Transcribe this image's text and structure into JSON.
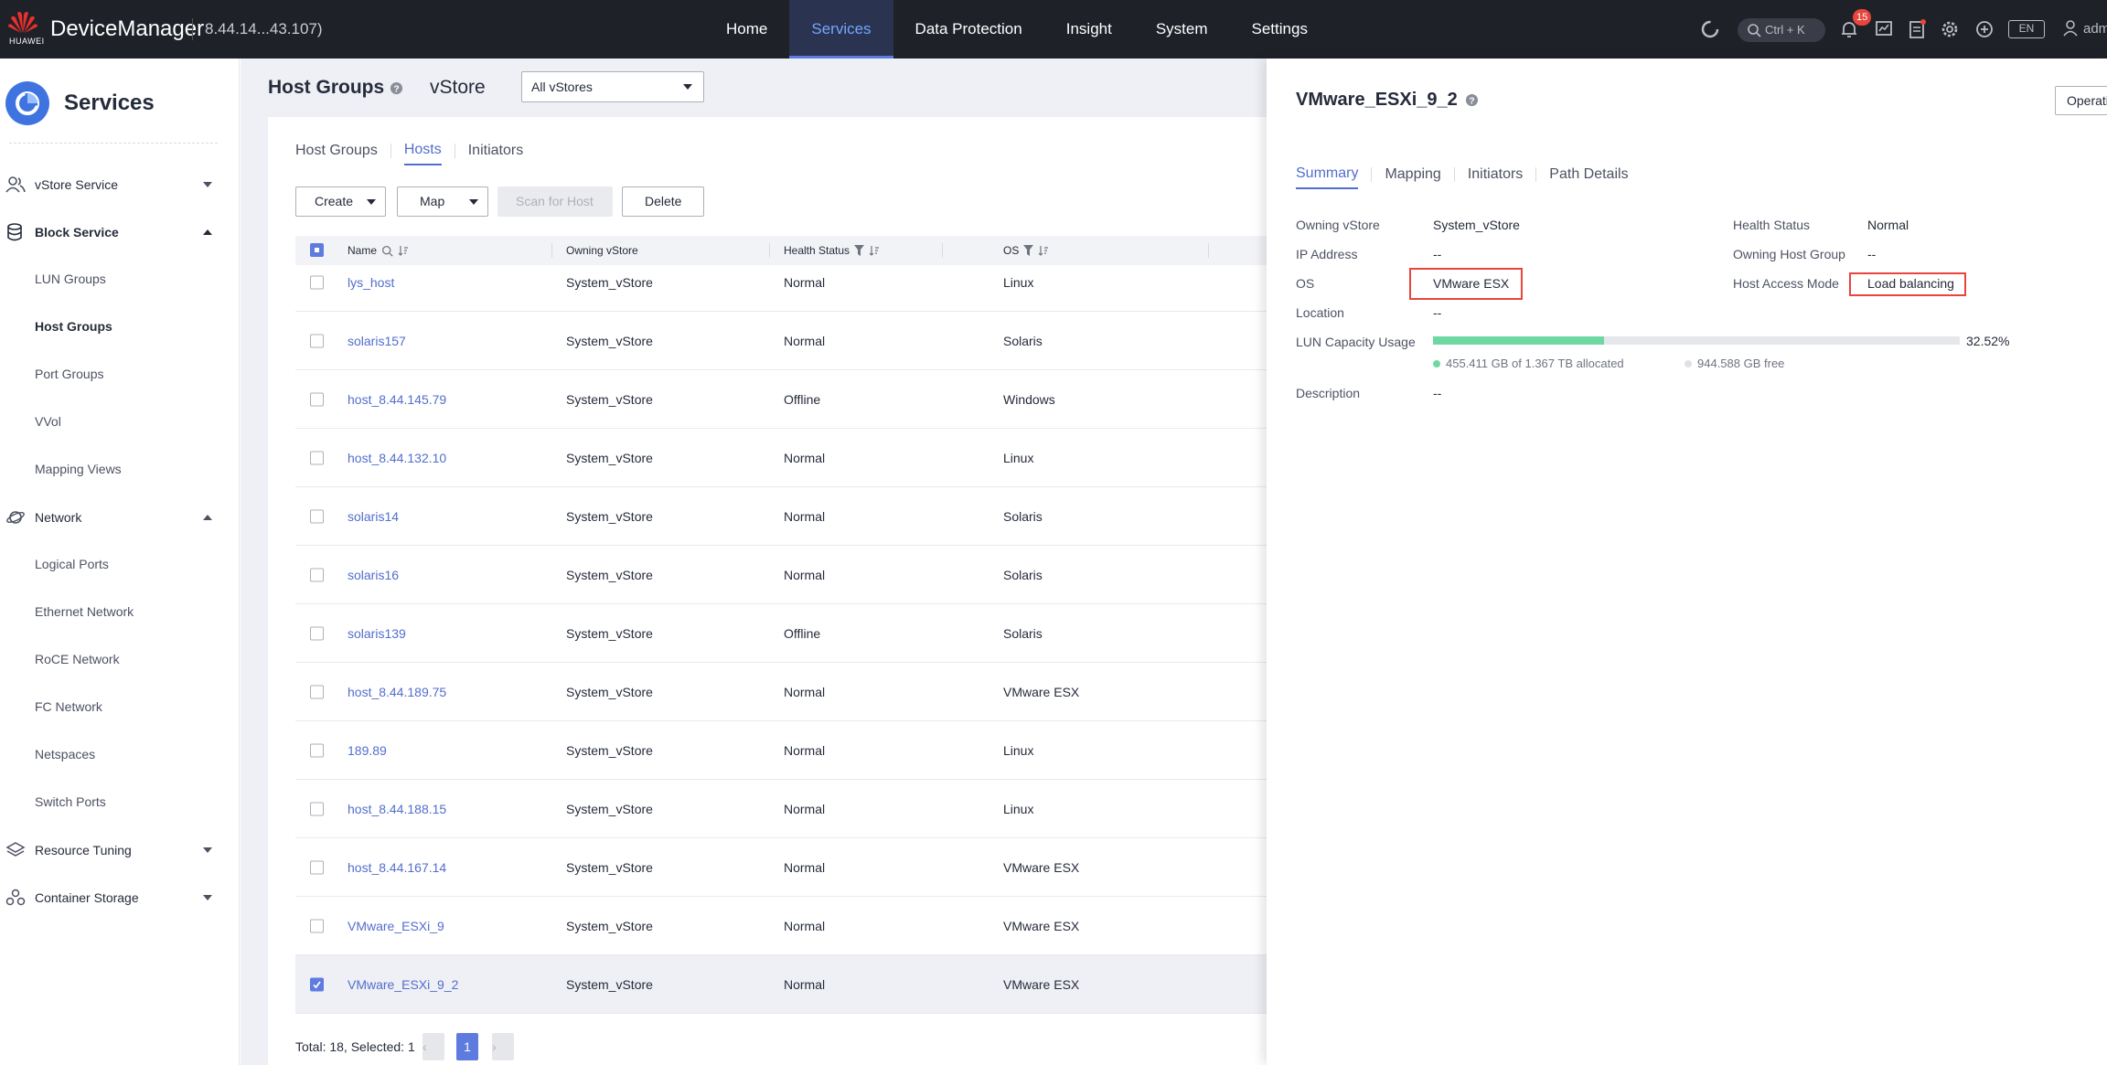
{
  "topbar": {
    "logo_text": "HUAWEI",
    "brand": "DeviceManager",
    "ip": "8.44.14...43.107)",
    "nav": [
      {
        "label": "Home"
      },
      {
        "label": "Services",
        "active": true
      },
      {
        "label": "Data Protection"
      },
      {
        "label": "Insight"
      },
      {
        "label": "System"
      },
      {
        "label": "Settings"
      }
    ],
    "search_hint": "Ctrl + K",
    "alarm_count": "15",
    "lang": "EN",
    "user": "adm"
  },
  "sidebar": {
    "title": "Services",
    "groups": [
      {
        "label": "vStore Service",
        "icon": "user-group-icon",
        "expanded": false
      },
      {
        "label": "Block Service",
        "icon": "database-icon",
        "expanded": true,
        "items": [
          "LUN Groups",
          "Host Groups",
          "Port Groups",
          "VVol",
          "Mapping Views"
        ],
        "active_item": "Host Groups"
      },
      {
        "label": "Network",
        "icon": "planet-icon",
        "expanded": true,
        "items": [
          "Logical Ports",
          "Ethernet Network",
          "RoCE Network",
          "FC Network",
          "Netspaces",
          "Switch Ports"
        ]
      },
      {
        "label": "Resource Tuning",
        "icon": "layers-icon",
        "expanded": false
      },
      {
        "label": "Container Storage",
        "icon": "containers-icon",
        "expanded": false
      }
    ]
  },
  "page": {
    "title": "Host Groups",
    "vstore_label": "vStore",
    "vstore_value": "All vStores",
    "tabs": [
      "Host Groups",
      "Hosts",
      "Initiators"
    ],
    "active_tab": "Hosts",
    "buttons": {
      "create": "Create",
      "map": "Map",
      "scan": "Scan for Host",
      "delete": "Delete"
    },
    "columns": [
      "Name",
      "Owning vStore",
      "Health Status",
      "OS"
    ],
    "rows": [
      {
        "name": "lys_host",
        "vstore": "System_vStore",
        "health": "Normal",
        "os": "Linux"
      },
      {
        "name": "solaris157",
        "vstore": "System_vStore",
        "health": "Normal",
        "os": "Solaris"
      },
      {
        "name": "host_8.44.145.79",
        "vstore": "System_vStore",
        "health": "Offline",
        "os": "Windows"
      },
      {
        "name": "host_8.44.132.10",
        "vstore": "System_vStore",
        "health": "Normal",
        "os": "Linux"
      },
      {
        "name": "solaris14",
        "vstore": "System_vStore",
        "health": "Normal",
        "os": "Solaris"
      },
      {
        "name": "solaris16",
        "vstore": "System_vStore",
        "health": "Normal",
        "os": "Solaris"
      },
      {
        "name": "solaris139",
        "vstore": "System_vStore",
        "health": "Offline",
        "os": "Solaris"
      },
      {
        "name": "host_8.44.189.75",
        "vstore": "System_vStore",
        "health": "Normal",
        "os": "VMware ESX"
      },
      {
        "name": "189.89",
        "vstore": "System_vStore",
        "health": "Normal",
        "os": "Linux"
      },
      {
        "name": "host_8.44.188.15",
        "vstore": "System_vStore",
        "health": "Normal",
        "os": "Linux"
      },
      {
        "name": "host_8.44.167.14",
        "vstore": "System_vStore",
        "health": "Normal",
        "os": "VMware ESX"
      },
      {
        "name": "VMware_ESXi_9",
        "vstore": "System_vStore",
        "health": "Normal",
        "os": "VMware ESX"
      },
      {
        "name": "VMware_ESXi_9_2",
        "vstore": "System_vStore",
        "health": "Normal",
        "os": "VMware ESX",
        "selected": true
      }
    ],
    "footer_total": "Total: 18, Selected: 1",
    "current_page": "1"
  },
  "detail": {
    "title": "VMware_ESXi_9_2",
    "operation_btn": "Operati",
    "tabs": [
      "Summary",
      "Mapping",
      "Initiators",
      "Path Details"
    ],
    "active_tab": "Summary",
    "fields": {
      "owning_vstore_k": "Owning vStore",
      "owning_vstore_v": "System_vStore",
      "health_k": "Health Status",
      "health_v": "Normal",
      "ip_k": "IP Address",
      "ip_v": "--",
      "host_group_k": "Owning Host Group",
      "host_group_v": "--",
      "os_k": "OS",
      "os_v": "VMware ESX",
      "access_mode_k": "Host Access Mode",
      "access_mode_v": "Load balancing",
      "location_k": "Location",
      "location_v": "--",
      "lun_k": "LUN Capacity Usage",
      "lun_pct": "32.52%",
      "allocated": "455.411 GB of 1.367 TB allocated",
      "free": "944.588 GB free",
      "desc_k": "Description",
      "desc_v": "--"
    },
    "lun_usage_fraction": 0.3252,
    "colors": {
      "allocated": "#6fd8a2",
      "free": "#dfe1e6",
      "highlight": "#e8453c"
    }
  }
}
